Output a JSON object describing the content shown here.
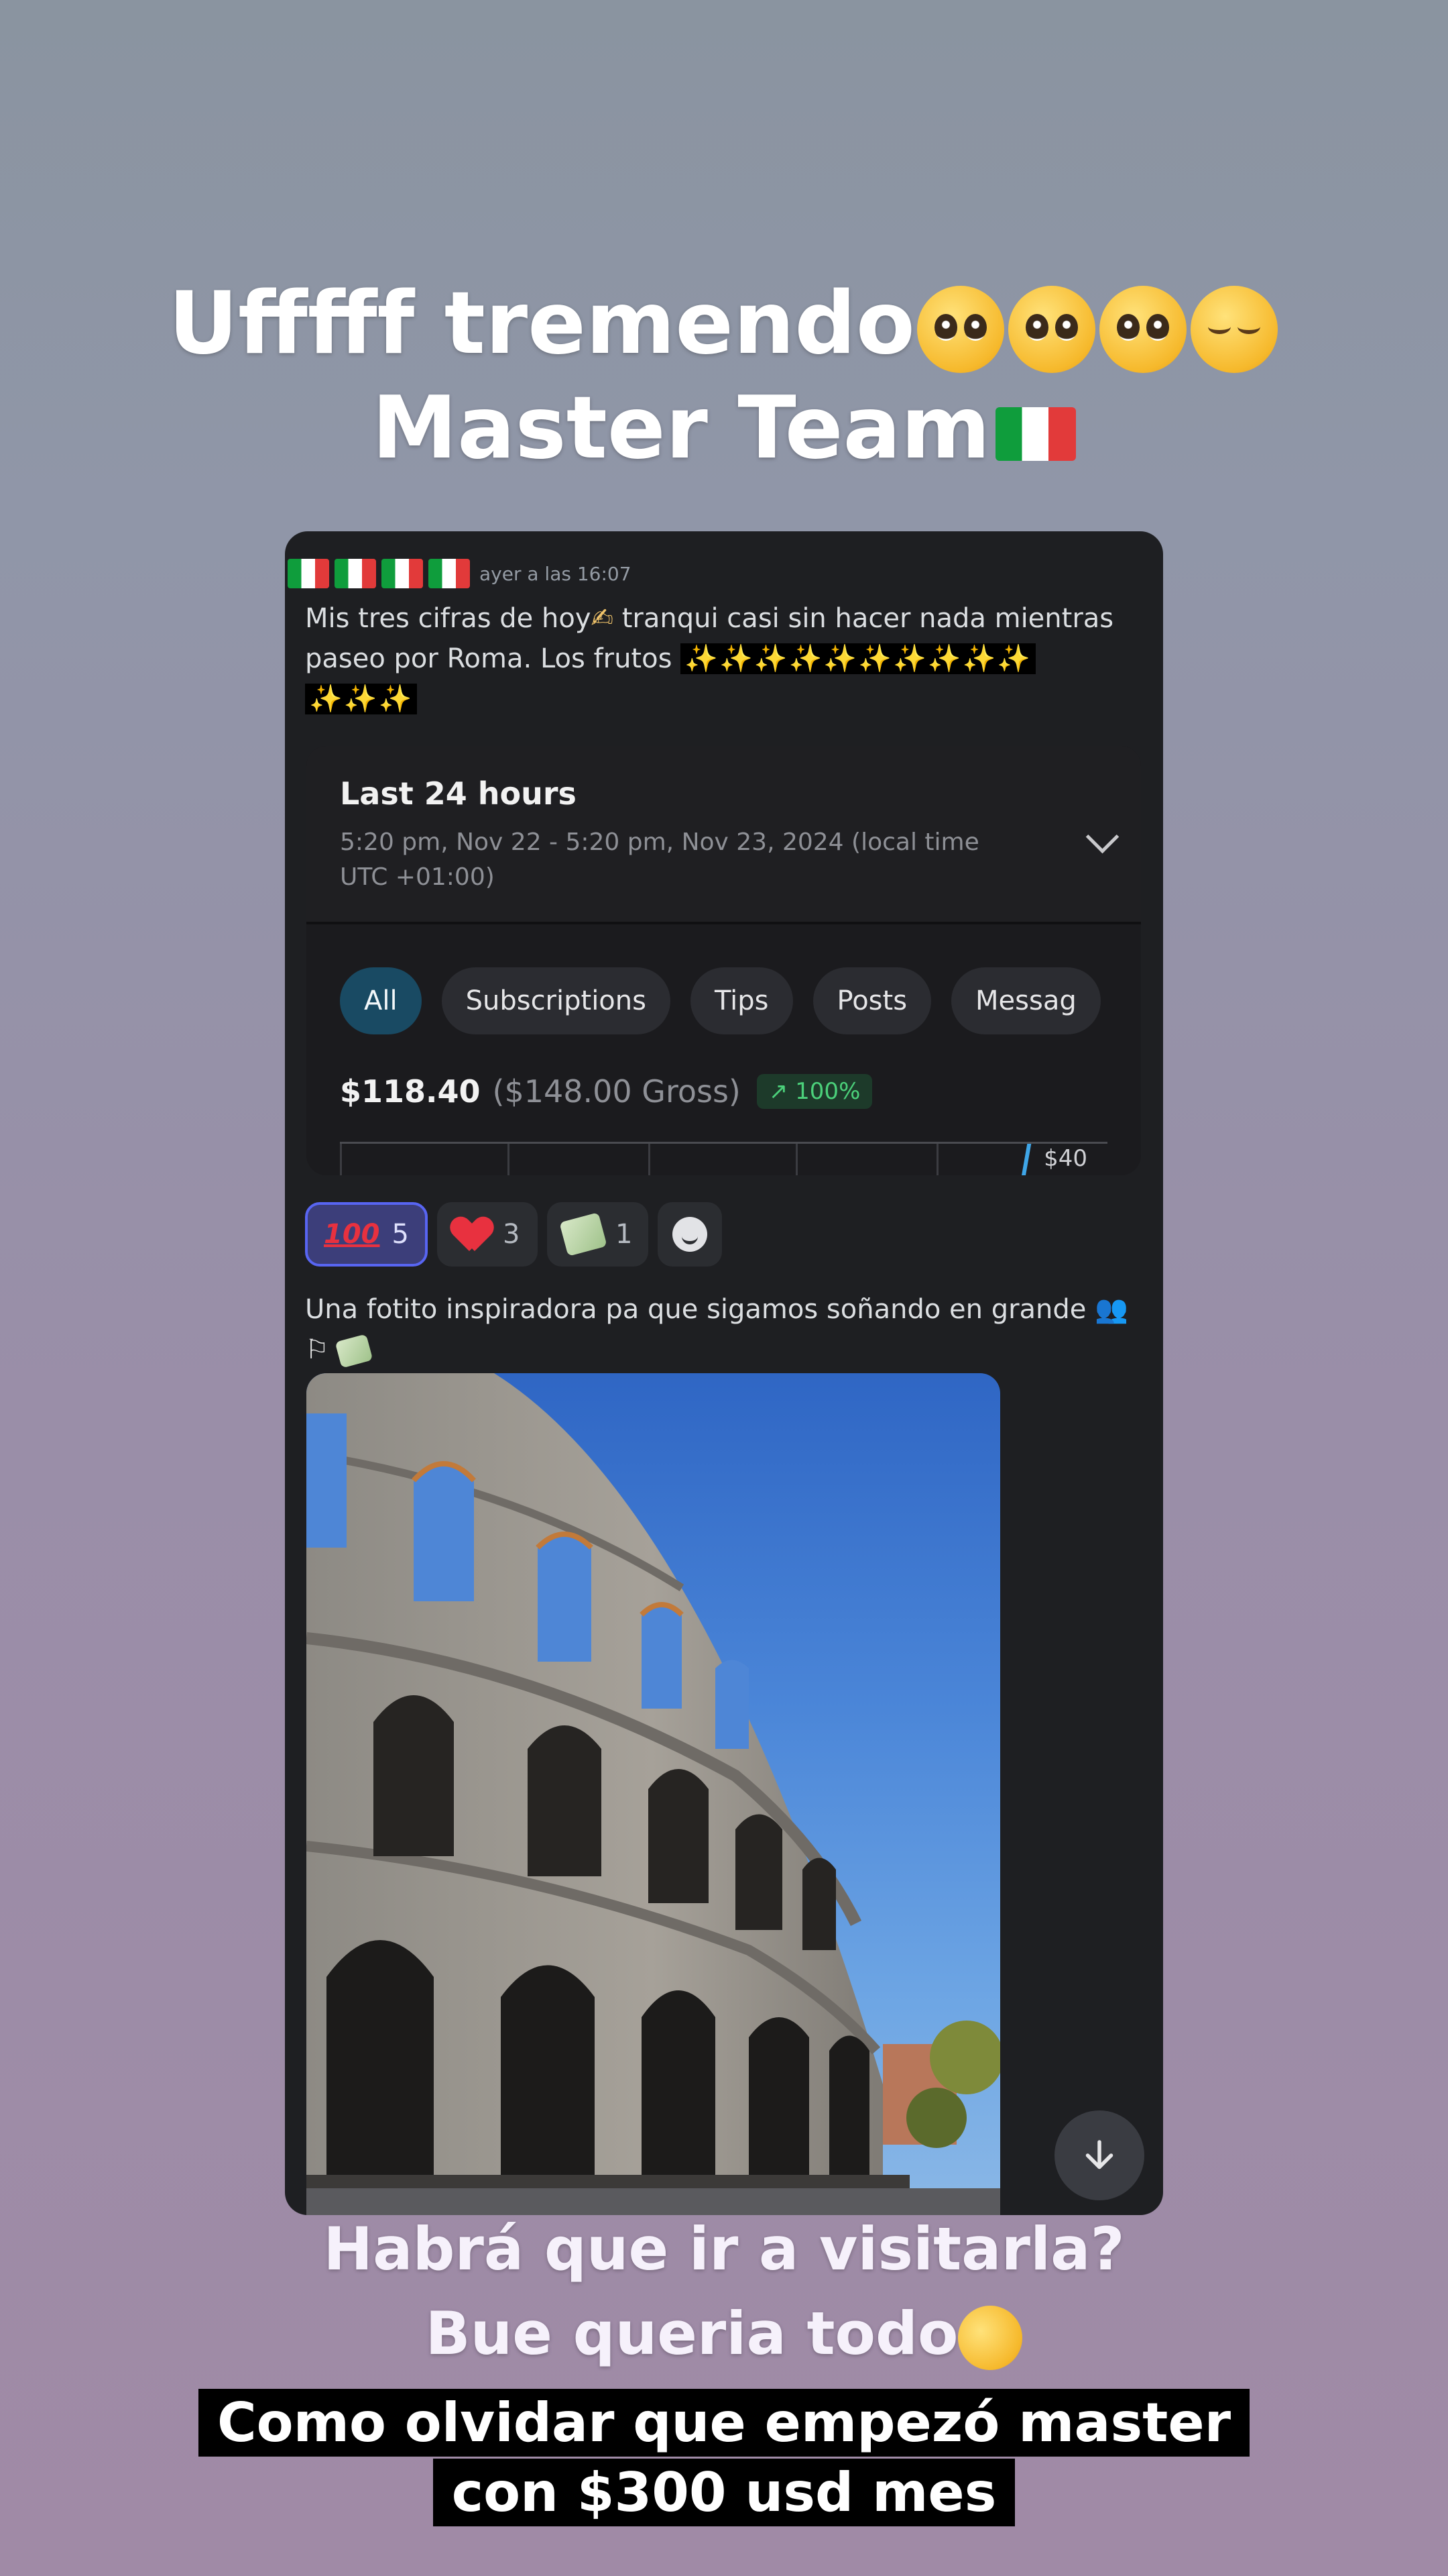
{
  "story": {
    "top_caption_line1": "Ufffff tremendo",
    "top_caption_line2": "Master Team",
    "mid_caption_line1": "Habrá que ir a visitarla?",
    "mid_caption_line2": "Bue queria todo",
    "bottom_caption_line1": "Como olvidar que empezó master",
    "bottom_caption_line2": "con $300 usd mes"
  },
  "message1": {
    "timestamp": "ayer a las 16:07",
    "text": "Mis tres cifras de hoy",
    "text_cont": " tranqui casi sin hacer nada mientras paseo por Roma. Los frutos",
    "sparkles_1": "✨✨✨✨✨✨✨✨✨✨",
    "sparkles_2": "✨✨✨"
  },
  "earnings_card": {
    "period_title": "Last 24 hours",
    "period_range": "5:20 pm, Nov 22 - 5:20 pm, Nov 23, 2024 (local time UTC +01:00)",
    "tabs": [
      "All",
      "Subscriptions",
      "Tips",
      "Posts",
      "Messag"
    ],
    "net": "$118.40",
    "gross": "($148.00 Gross)",
    "change": "↗ 100%",
    "axis_tick": "$40"
  },
  "reactions": [
    {
      "icon": "hundred-points-icon",
      "count": "5",
      "selected": true
    },
    {
      "icon": "red-heart-icon",
      "count": "3",
      "selected": false
    },
    {
      "icon": "money-wings-icon",
      "count": "1",
      "selected": false
    }
  ],
  "message2": {
    "text": "Una fotito inspiradora pa que sigamos soñando en grande"
  },
  "colors": {
    "discord_bg": "#1e1f22",
    "accent_blurple": "#5865f2",
    "positive_green": "#4bd07a"
  }
}
